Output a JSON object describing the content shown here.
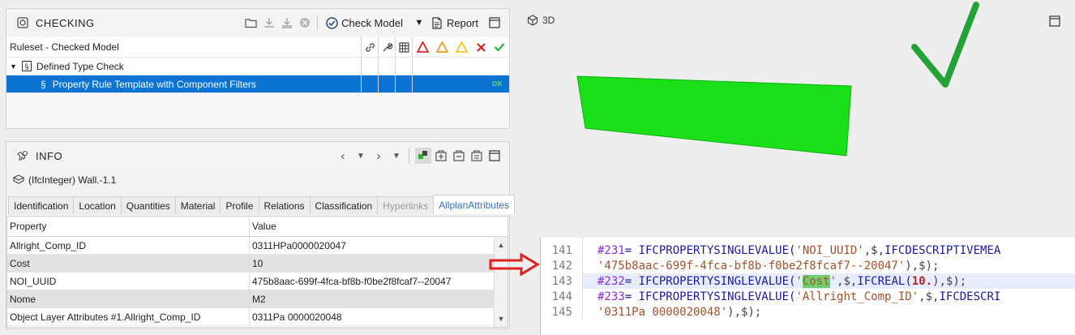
{
  "checking": {
    "title": "CHECKING",
    "check_model_label": "Check Model",
    "report_label": "Report",
    "column_header": "Ruleset - Checked Model",
    "rows": [
      {
        "label": "Defined Type Check",
        "section": "§"
      },
      {
        "label": "Property Rule Template with Component Filters",
        "section": "§",
        "status": "OK"
      }
    ]
  },
  "info": {
    "title": "INFO",
    "object_label": "(IfcInteger) Wall.-1.1",
    "tabs": [
      "Identification",
      "Location",
      "Quantities",
      "Material",
      "Profile",
      "Relations",
      "Classification",
      "Hyperlinks",
      "AllplanAttributes"
    ],
    "active_tab": "AllplanAttributes",
    "disabled_tab": "Hyperlinks",
    "table": {
      "headers": [
        "Property",
        "Value"
      ],
      "rows": [
        [
          "Allright_Comp_ID",
          "0311HPa0000020047"
        ],
        [
          "Cost",
          "10"
        ],
        [
          "NOI_UUID",
          "475b8aac-699f-4fca-bf8b-f0be2f8fcaf7--20047"
        ],
        [
          "Nome",
          "M2"
        ],
        [
          "Object Layer Attributes #1.Allright_Comp_ID",
          "0311Pa 0000020048"
        ]
      ]
    }
  },
  "view3d": {
    "label": "3D",
    "wall_color": "#19e019",
    "check_color": "#22a336"
  },
  "code": {
    "lines": [
      {
        "n": "141",
        "segs": [
          [
            "c-hash",
            "#231"
          ],
          [
            "",
            "= IFCPROPERTYSINGLEVALUE("
          ],
          [
            "c-str",
            "'NOI_UUID'"
          ],
          [
            "c-sym",
            ",$,"
          ],
          [
            "",
            "IFCDESCRIPTIVEMEA"
          ]
        ]
      },
      {
        "n": "142",
        "segs": [
          [
            "c-str",
            "'475b8aac-699f-4fca-bf8b-f0be2f8fcaf7--20047'"
          ],
          [
            "c-sym",
            "),$);"
          ]
        ]
      },
      {
        "n": "143",
        "hl": true,
        "segs": [
          [
            "c-hash",
            "#232"
          ],
          [
            "",
            "= IFCPROPERTYSINGLEVALUE("
          ],
          [
            "c-str",
            "'"
          ],
          [
            "c-match",
            "Cost"
          ],
          [
            "c-str",
            "'"
          ],
          [
            "c-sym",
            ",$,"
          ],
          [
            "",
            "IFCREAL("
          ],
          [
            "c-num",
            "10."
          ],
          [
            "c-sym",
            "),$);"
          ]
        ]
      },
      {
        "n": "144",
        "segs": [
          [
            "c-hash",
            "#233"
          ],
          [
            "",
            "= IFCPROPERTYSINGLEVALUE("
          ],
          [
            "c-str",
            "'Allright_Comp_ID'"
          ],
          [
            "c-sym",
            ",$,"
          ],
          [
            "",
            "IFCDESCRI"
          ]
        ]
      },
      {
        "n": "145",
        "segs": [
          [
            "c-str",
            "'0311Pa 0000020048'"
          ],
          [
            "c-sym",
            "),$);"
          ]
        ]
      }
    ]
  },
  "colors": {
    "selection": "#0a74d5",
    "arrow": "#e02020"
  }
}
